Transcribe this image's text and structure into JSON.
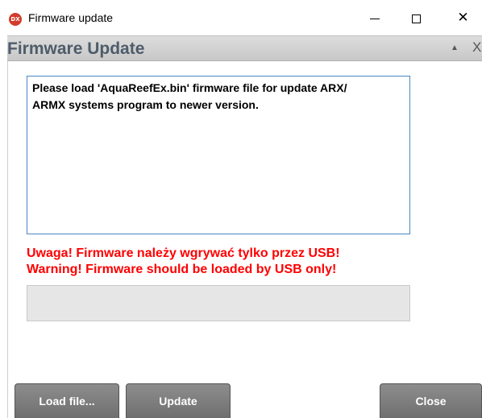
{
  "window": {
    "title": "Firmware update",
    "icon_label": "DX"
  },
  "header": {
    "title": "Firmware Update",
    "collapse_glyph": "▲",
    "close_glyph": "X"
  },
  "message": {
    "text": "Please load 'AquaReefEx.bin' firmware file for update ARX/\nARMX systems program to newer version."
  },
  "warnings": [
    "Uwaga! Firmware należy wgrywać tylko przez USB!",
    "Warning! Firmware should be loaded by USB only!"
  ],
  "progress": {
    "value": 0
  },
  "buttons": {
    "load": "Load file...",
    "update": "Update",
    "close": "Close"
  },
  "colors": {
    "warning": "#ff0000",
    "header_text": "#4e5c6a",
    "button_bg": "#7d7d7d",
    "message_border": "#4a86c5"
  }
}
